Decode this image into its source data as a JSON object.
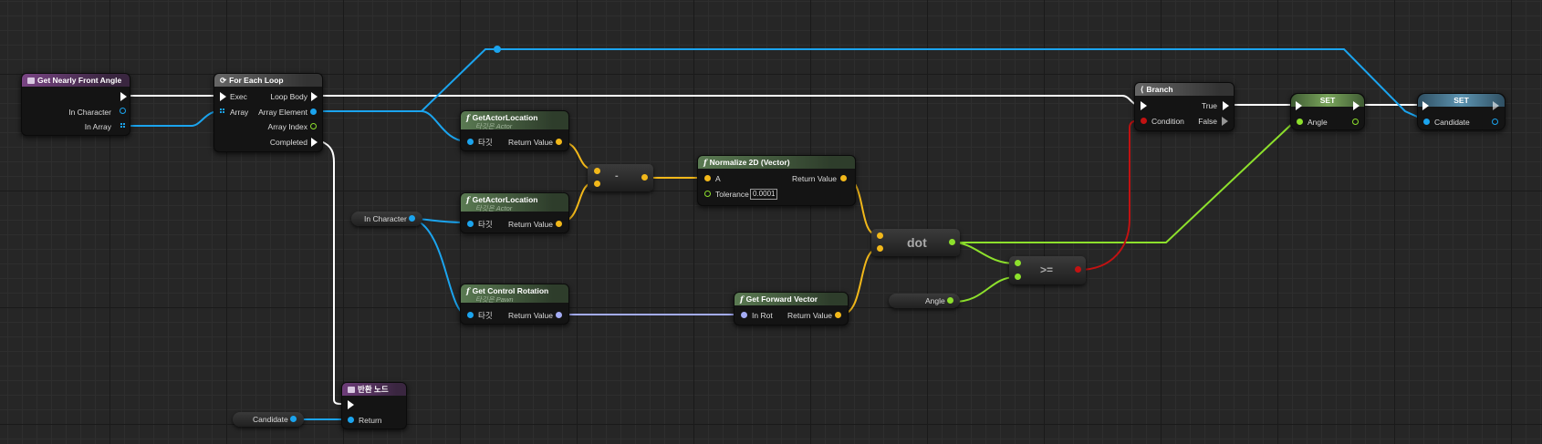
{
  "function_entry": {
    "title": "Get Nearly Front Angle",
    "pins": [
      "In Character",
      "In Array"
    ]
  },
  "foreach": {
    "title": "For Each Loop",
    "inputs": [
      "Exec",
      "Array"
    ],
    "outputs": [
      "Loop Body",
      "Array Element",
      "Array Index",
      "Completed"
    ]
  },
  "get_actor_location_1": {
    "title": "GetActorLocation",
    "subtitle": "타깃은 Actor",
    "target": "타깃",
    "ret": "Return Value"
  },
  "get_actor_location_2": {
    "title": "GetActorLocation",
    "subtitle": "타깃은 Actor",
    "target": "타깃",
    "ret": "Return Value"
  },
  "subtract": {
    "symbol": "-"
  },
  "normalize": {
    "title": "Normalize 2D (Vector)",
    "a": "A",
    "tolerance_label": "Tolerance",
    "tolerance_value": "0.0001",
    "ret": "Return Value"
  },
  "in_character_var": {
    "label": "In Character"
  },
  "get_control_rotation": {
    "title": "Get Control Rotation",
    "subtitle": "타깃은 Pawn",
    "target": "타깃",
    "ret": "Return Value"
  },
  "get_forward_vector": {
    "title": "Get Forward Vector",
    "in": "In Rot",
    "ret": "Return Value"
  },
  "dot": {
    "symbol": "dot"
  },
  "angle_var": {
    "label": "Angle"
  },
  "gte": {
    "symbol": ">="
  },
  "branch": {
    "title": "Branch",
    "condition": "Condition",
    "true_label": "True",
    "false_label": "False"
  },
  "set_angle": {
    "title": "SET",
    "pin": "Angle"
  },
  "set_candidate": {
    "title": "SET",
    "pin": "Candidate"
  },
  "return_node": {
    "title": "반환 노드",
    "pin": "Return"
  },
  "candidate_var": {
    "label": "Candidate"
  },
  "colors": {
    "exec": "#ffffff",
    "object": "#1ba4ee",
    "vector": "#f2b81a",
    "float": "#8de02c",
    "bool": "#c21212",
    "rotator": "#a4acf5"
  }
}
